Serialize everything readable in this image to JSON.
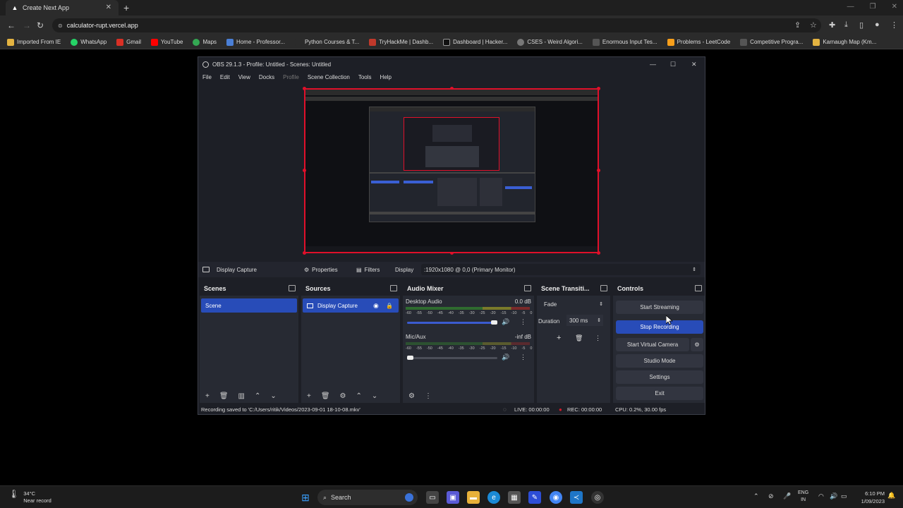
{
  "browser": {
    "tab_title": "Create Next App",
    "url": "calculator-rupt.vercel.app",
    "bookmarks": [
      "Imported From IE",
      "WhatsApp",
      "Gmail",
      "YouTube",
      "Maps",
      "Home - Professor...",
      "Python Courses & T...",
      "TryHackMe | Dashb...",
      "Dashboard | Hacker...",
      "CSES - Weird Algori...",
      "Enormous Input Tes...",
      "Problems - LeetCode",
      "Competitive Progra...",
      "Karnaugh Map (Km..."
    ]
  },
  "obs": {
    "title": "OBS 29.1.3 - Profile: Untitled - Scenes: Untitled",
    "menu": [
      "File",
      "Edit",
      "View",
      "Docks",
      "Profile",
      "Scene Collection",
      "Tools",
      "Help"
    ],
    "source_bar": {
      "source_name": "Display Capture",
      "properties": "Properties",
      "filters": "Filters",
      "display_label": "Display",
      "display_value": ":1920x1080 @ 0,0 (Primary Monitor)"
    },
    "scenes": {
      "title": "Scenes",
      "items": [
        "Scene"
      ]
    },
    "sources": {
      "title": "Sources",
      "items": [
        "Display Capture"
      ]
    },
    "audio_mixer": {
      "title": "Audio Mixer",
      "ticks": [
        "-60",
        "-55",
        "-50",
        "-45",
        "-40",
        "-35",
        "-30",
        "-25",
        "-20",
        "-15",
        "-10",
        "-5",
        "0"
      ],
      "channels": [
        {
          "name": "Desktop Audio",
          "level": "0.0 dB",
          "volume": 1.0
        },
        {
          "name": "Mic/Aux",
          "level": "-inf dB",
          "volume": 0.0
        }
      ]
    },
    "transitions": {
      "title": "Scene Transiti...",
      "selected": "Fade",
      "duration_label": "Duration",
      "duration_value": "300 ms"
    },
    "controls": {
      "title": "Controls",
      "buttons": [
        "Start Streaming",
        "Stop Recording",
        "Start Virtual Camera",
        "Studio Mode",
        "Settings",
        "Exit"
      ]
    },
    "status": {
      "message": "Recording saved to 'C:/Users/ritik/Videos/2023-09-01 18-10-08.mkv'",
      "live": "LIVE: 00:00:00",
      "rec": "REC: 00:00:00",
      "cpu": "CPU: 0.2%, 30.00 fps"
    }
  },
  "taskbar": {
    "weather_temp": "34°C",
    "weather_desc": "Near record",
    "search": "Search",
    "lang1": "ENG",
    "lang2": "IN",
    "time": "6:10 PM",
    "date": "1/09/2023"
  }
}
